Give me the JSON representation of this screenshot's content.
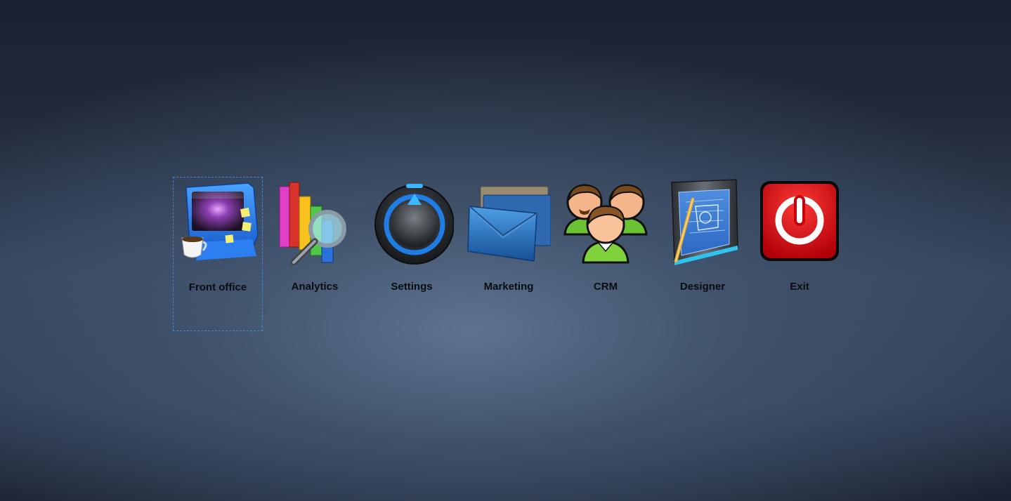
{
  "launcher": {
    "items": [
      {
        "label": "Front office",
        "icon": "front-office-icon",
        "focused": true
      },
      {
        "label": "Analytics",
        "icon": "analytics-icon",
        "focused": false
      },
      {
        "label": "Settings",
        "icon": "settings-icon",
        "focused": false
      },
      {
        "label": "Marketing",
        "icon": "marketing-icon",
        "focused": false
      },
      {
        "label": "CRM",
        "icon": "crm-icon",
        "focused": false
      },
      {
        "label": "Designer",
        "icon": "designer-icon",
        "focused": false
      },
      {
        "label": "Exit",
        "icon": "exit-icon",
        "focused": false
      }
    ]
  },
  "colors": {
    "focus_outline": "#3f86d8",
    "label_text": "#0a0d12",
    "exit_red": "#d6000a"
  }
}
